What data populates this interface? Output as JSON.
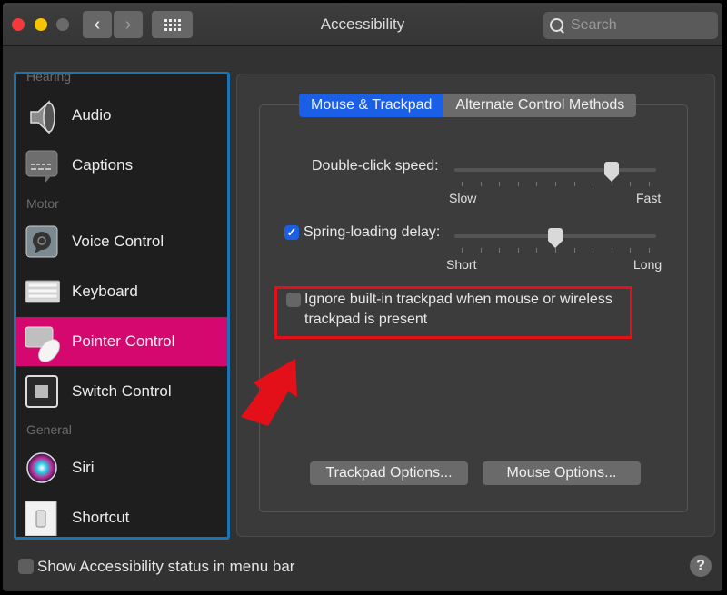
{
  "window": {
    "title": "Accessibility",
    "search_placeholder": "Search",
    "nav": {
      "back": "‹",
      "forward": "›"
    }
  },
  "sidebar": {
    "sections": [
      {
        "label": "Hearing"
      },
      {
        "label": "Motor"
      },
      {
        "label": "General"
      }
    ],
    "items": [
      {
        "label": "Audio",
        "icon": "speaker-icon"
      },
      {
        "label": "Captions",
        "icon": "captions-icon"
      },
      {
        "label": "Voice Control",
        "icon": "voice-control-icon"
      },
      {
        "label": "Keyboard",
        "icon": "keyboard-icon"
      },
      {
        "label": "Pointer Control",
        "icon": "pointer-control-icon",
        "selected": true
      },
      {
        "label": "Switch Control",
        "icon": "switch-control-icon"
      },
      {
        "label": "Siri",
        "icon": "siri-icon"
      },
      {
        "label": "Shortcut",
        "icon": "shortcut-icon"
      }
    ],
    "selected_color": "#d5086f"
  },
  "tabs": [
    {
      "label": "Mouse & Trackpad",
      "active": true
    },
    {
      "label": "Alternate Control Methods",
      "active": false
    }
  ],
  "settings": {
    "double_click": {
      "label": "Double-click speed:",
      "min_label": "Slow",
      "max_label": "Fast",
      "ticks": 11,
      "value_fraction": 0.8
    },
    "spring_loading": {
      "label": "Spring-loading delay:",
      "checked": true,
      "check_glyph": "✓",
      "min_label": "Short",
      "max_label": "Long",
      "ticks": 11,
      "value_fraction": 0.5
    },
    "ignore_trackpad": {
      "label_line1": "Ignore built-in trackpad when mouse or wireless",
      "label_line2": "trackpad is present",
      "checked": false
    }
  },
  "buttons": {
    "trackpad_options": "Trackpad Options...",
    "mouse_options": "Mouse Options..."
  },
  "footer": {
    "show_status_label": "Show Accessibility status in menu bar",
    "show_status_checked": false,
    "help": "?"
  },
  "annotations": {
    "highlight_color": "#e3101a"
  }
}
